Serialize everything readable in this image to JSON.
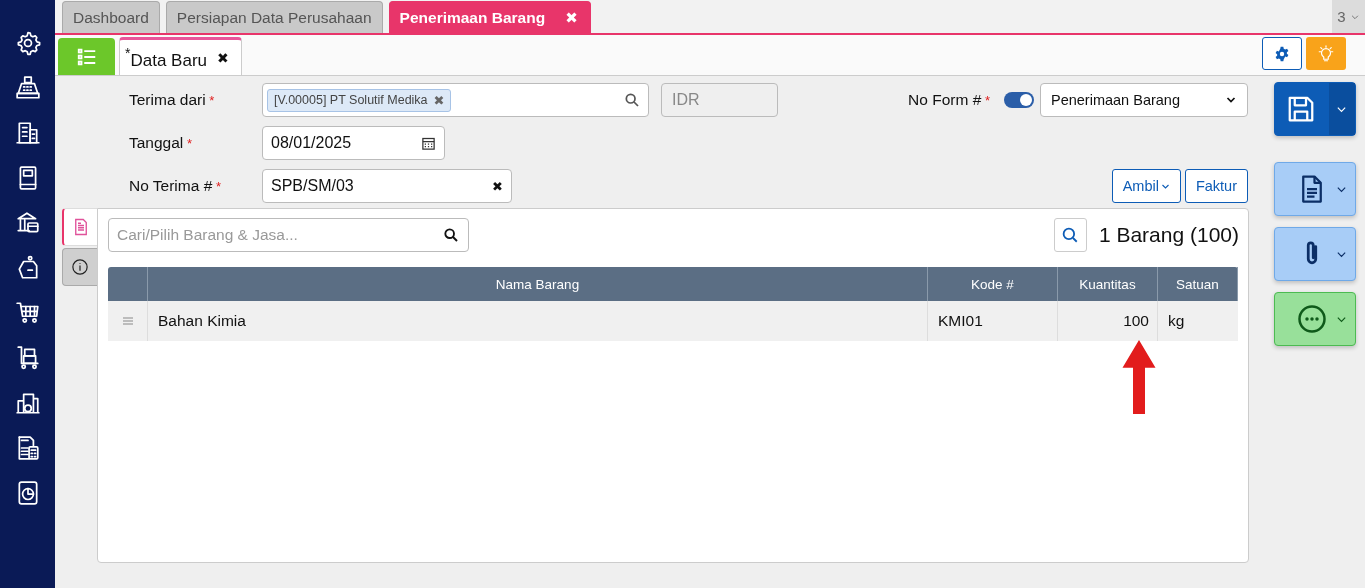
{
  "sidebar": [
    {
      "kind": "settings"
    },
    {
      "kind": "register"
    },
    {
      "kind": "building"
    },
    {
      "kind": "book"
    },
    {
      "kind": "bank"
    },
    {
      "kind": "pricetag"
    },
    {
      "kind": "cart"
    },
    {
      "kind": "trolley"
    },
    {
      "kind": "factory"
    },
    {
      "kind": "tax"
    },
    {
      "kind": "report"
    }
  ],
  "top_tabs": [
    {
      "label": "Dashboard",
      "selected": false
    },
    {
      "label": "Persiapan Data Perusahaan",
      "selected": false
    },
    {
      "label": "Penerimaan Barang",
      "selected": true,
      "close": "✖"
    }
  ],
  "tab_count": "3",
  "sub_tabs": [
    {
      "label": "Data Baru",
      "modified_mark": "*",
      "close": "✖"
    }
  ],
  "form": {
    "vendor": {
      "label": "Terima dari",
      "required_mark": "*",
      "tag": "[V.00005] PT Solutif Medika",
      "tag_close": "✖"
    },
    "currency": {
      "value": "IDR",
      "disabled": true
    },
    "no_form": {
      "label": "No Form #",
      "required_mark": "*",
      "auto": true,
      "value": "Penerimaan Barang"
    },
    "date": {
      "label": "Tanggal",
      "required_mark": "*",
      "value": "08/01/2025"
    },
    "receipt_no": {
      "label": "No Terima #",
      "required_mark": "*",
      "value": "SPB/SM/03",
      "clear": "✖"
    },
    "buttons": [
      {
        "label": "Ambil",
        "dropdown": true
      },
      {
        "label": "Faktur",
        "dropdown": false
      }
    ]
  },
  "side_tabs": [
    {
      "kind": "document",
      "selected": true
    },
    {
      "kind": "info",
      "selected": false
    }
  ],
  "item_search": {
    "placeholder": "Cari/Pilih Barang & Jasa..."
  },
  "item_count": "1 Barang (100)",
  "table": {
    "columns": [
      "Nama Barang",
      "Kode #",
      "Kuantitas",
      "Satuan"
    ],
    "rows": [
      {
        "cells": [
          "Bahan Kimia",
          "KMI01",
          "100",
          "kg"
        ]
      }
    ]
  },
  "action_buttons": [
    {
      "kind": "save"
    },
    {
      "kind": "document"
    },
    {
      "kind": "attachment"
    },
    {
      "kind": "more"
    }
  ]
}
